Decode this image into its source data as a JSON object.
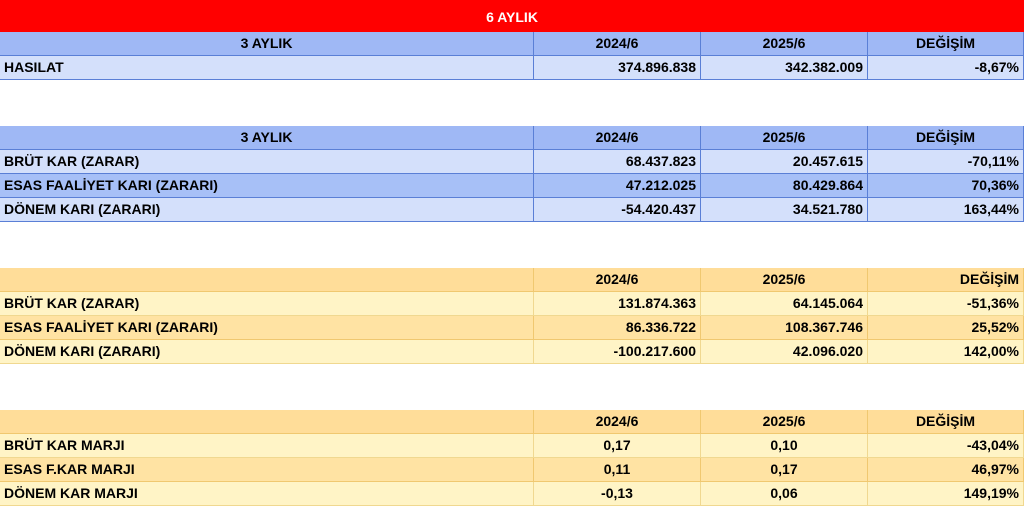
{
  "title": "6 AYLIK",
  "section1": {
    "header": [
      "3 AYLIK",
      "2024/6",
      "2025/6",
      "DEĞİŞİM"
    ],
    "rows": [
      [
        "HASILAT",
        "374.896.838",
        "342.382.009",
        "-8,67%"
      ]
    ]
  },
  "section2": {
    "header": [
      "3 AYLIK",
      "2024/6",
      "2025/6",
      "DEĞİŞİM"
    ],
    "rows": [
      [
        "BRÜT KAR (ZARAR)",
        "68.437.823",
        "20.457.615",
        "-70,11%"
      ],
      [
        "ESAS FAALİYET KARI (ZARARI)",
        "47.212.025",
        "80.429.864",
        "70,36%"
      ],
      [
        "DÖNEM KARI (ZARARI)",
        "-54.420.437",
        "34.521.780",
        "163,44%"
      ]
    ]
  },
  "section3": {
    "header": [
      "",
      "2024/6",
      "2025/6",
      "DEĞİŞİM"
    ],
    "rows": [
      [
        "BRÜT KAR (ZARAR)",
        "131.874.363",
        "64.145.064",
        "-51,36%"
      ],
      [
        "ESAS FAALİYET KARI (ZARARI)",
        "86.336.722",
        "108.367.746",
        "25,52%"
      ],
      [
        "DÖNEM KARI (ZARARI)",
        "-100.217.600",
        "42.096.020",
        "142,00%"
      ]
    ]
  },
  "section4": {
    "header": [
      "",
      "2024/6",
      "2025/6",
      "DEĞİŞİM"
    ],
    "rows": [
      [
        "BRÜT KAR MARJI",
        "0,17",
        "0,10",
        "-43,04%"
      ],
      [
        "ESAS F.KAR MARJI",
        "0,11",
        "0,17",
        "46,97%"
      ],
      [
        "DÖNEM KAR MARJI",
        "-0,13",
        "0,06",
        "149,19%"
      ]
    ]
  }
}
